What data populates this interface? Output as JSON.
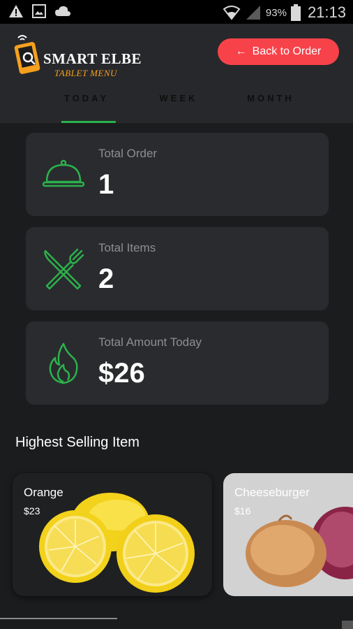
{
  "status_bar": {
    "battery": "93%",
    "time": "21:13",
    "icons": [
      "warning-icon",
      "image-icon",
      "cloud-icon",
      "wifi-icon",
      "signal-icon",
      "battery-icon"
    ]
  },
  "header": {
    "logo_title": "SMART ELBE",
    "logo_subtitle": "TABLET MENU",
    "back_button": "Back to Order",
    "accent_color": "#f7424a",
    "brand_color": "#f5a01e"
  },
  "tabs": [
    {
      "label": "TODAY",
      "active": true
    },
    {
      "label": "WEEK",
      "active": false
    },
    {
      "label": "MONTH",
      "active": false
    }
  ],
  "stats": [
    {
      "label": "Total Order",
      "value": "1",
      "icon": "food-cloche-icon"
    },
    {
      "label": "Total Items",
      "value": "2",
      "icon": "fork-knife-icon"
    },
    {
      "label": "Total Amount Today",
      "value": "$26",
      "icon": "flame-icon"
    }
  ],
  "highlight_color": "#2bb24c",
  "section_title": "Highest Selling Item",
  "products": [
    {
      "name": "Orange",
      "price": "$23"
    },
    {
      "name": "Cheeseburger",
      "price": "$16"
    }
  ]
}
